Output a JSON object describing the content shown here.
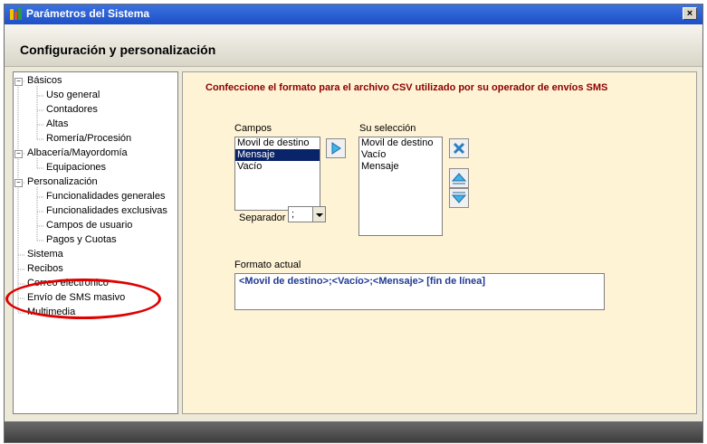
{
  "window": {
    "title": "Parámetros del Sistema",
    "close_label": "×"
  },
  "header": {
    "title": "Configuración y personalización"
  },
  "tree": {
    "items": [
      {
        "label": "Básicos",
        "level": 0,
        "expanded": true
      },
      {
        "label": "Uso general",
        "level": 1
      },
      {
        "label": "Contadores",
        "level": 1
      },
      {
        "label": "Altas",
        "level": 1
      },
      {
        "label": "Romería/Procesión",
        "level": 1
      },
      {
        "label": "Albacería/Mayordomía",
        "level": 0,
        "expanded": true
      },
      {
        "label": "Equipaciones",
        "level": 1
      },
      {
        "label": "Personalización",
        "level": 0,
        "expanded": true
      },
      {
        "label": "Funcionalidades generales",
        "level": 1
      },
      {
        "label": "Funcionalidades exclusivas",
        "level": 1
      },
      {
        "label": "Campos de usuario",
        "level": 1
      },
      {
        "label": "Pagos y Cuotas",
        "level": 1
      },
      {
        "label": "Sistema",
        "level": 0
      },
      {
        "label": "Recibos",
        "level": 0
      },
      {
        "label": "Correo electrónico",
        "level": 0
      },
      {
        "label": "Envío de SMS masivo",
        "level": 0,
        "highlighted": true
      },
      {
        "label": "Multimedia",
        "level": 0
      }
    ]
  },
  "main": {
    "instruction": "Confeccione el formato para el archivo CSV utilizado por su operador de envíos SMS",
    "campos_label": "Campos",
    "campos": [
      {
        "label": "Movil de destino",
        "selected": false
      },
      {
        "label": "Mensaje",
        "selected": true
      },
      {
        "label": "Vacío",
        "selected": false
      }
    ],
    "seleccion_label": "Su selección",
    "seleccion": [
      {
        "label": "Movil de destino"
      },
      {
        "label": "Vacío"
      },
      {
        "label": "Mensaje"
      }
    ],
    "separador_label": "Separador",
    "separador_value": ";",
    "formato_label": "Formato actual",
    "formato_value": "<Movil de destino>;<Vacío>;<Mensaje> [fin de línea]"
  },
  "colors": {
    "title_bar": "#1d4fc6",
    "instruction_text": "#8b0000",
    "content_bg": "#fff3d6",
    "selection_bg": "#0a246a",
    "format_text": "#1f3a93",
    "highlight_ring": "#e00000"
  }
}
